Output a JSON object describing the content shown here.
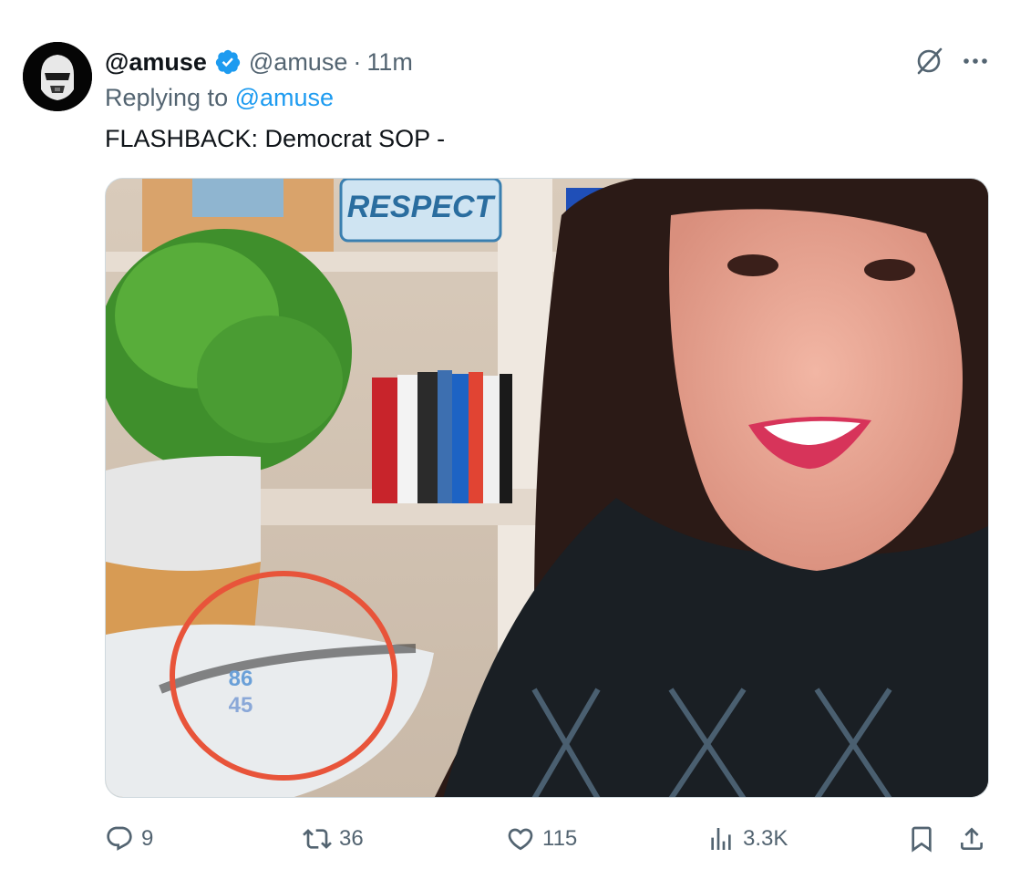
{
  "tweet": {
    "display_name": "@amuse",
    "handle": "@amuse",
    "separator": "·",
    "time": "11m",
    "replying_prefix": "Replying to",
    "replying_to": "@amuse",
    "text": "FLASHBACK: Democrat SOP -",
    "avatar_icon": "stormtrooper-avatar"
  },
  "media": {
    "sign_text": "RESPECT",
    "sticker_line1": "86",
    "sticker_line2": "45",
    "circle_color": "#e8543a"
  },
  "actions": {
    "replies": "9",
    "retweets": "36",
    "likes": "115",
    "views": "3.3K"
  },
  "colors": {
    "verified": "#1d9bf0",
    "link": "#1d9bf0",
    "muted": "#536471",
    "text": "#0f1419"
  }
}
